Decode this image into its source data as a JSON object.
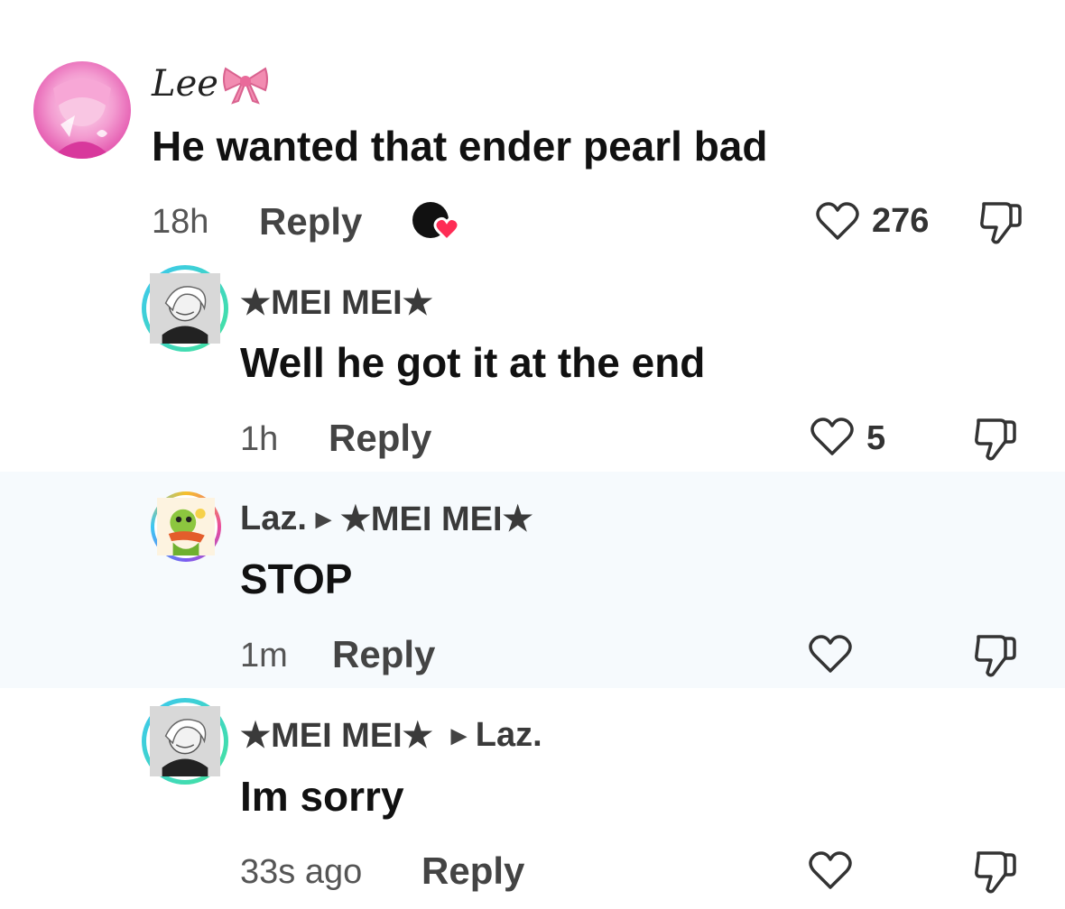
{
  "comments": [
    {
      "username": "Lee",
      "text": "He wanted that ender pearl bad",
      "time": "18h",
      "reply_label": "Reply",
      "likes": "276"
    },
    {
      "username": "★MEI MEI★",
      "text": "Well he got it at the end",
      "time": "1h",
      "reply_label": "Reply",
      "likes": "5"
    },
    {
      "username": "Laz.",
      "reply_to": "★MEI MEI★",
      "text": "STOP",
      "time": "1m",
      "reply_label": "Reply",
      "likes": ""
    },
    {
      "username": "★MEI MEI★",
      "reply_to": "Laz.",
      "text": "Im sorry",
      "time": "33s ago",
      "reply_label": "Reply",
      "likes": ""
    }
  ],
  "icons": {
    "like": "heart-outline-icon",
    "dislike": "thumbs-down-icon",
    "creator_liked": "creator-liked-icon",
    "bow": "pink-bow-emoji"
  },
  "colors": {
    "ring_gradient_start": "#3cc7f2",
    "ring_gradient_end": "#43e39b",
    "highlight_bg": "#f6fafd",
    "creator_heart": "#fe2c55"
  }
}
